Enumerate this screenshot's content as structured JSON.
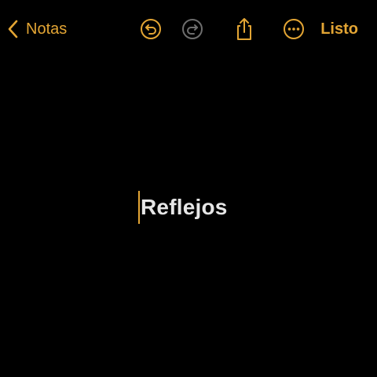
{
  "toolbar": {
    "back_label": "Notas",
    "done_label": "Listo",
    "icons": {
      "back": "chevron-left-icon",
      "undo": "undo-icon",
      "redo": "redo-icon",
      "share": "share-icon",
      "more": "more-icon"
    },
    "redo_enabled": false
  },
  "note": {
    "title": "Reflejos"
  },
  "colors": {
    "accent": "#e3a534",
    "background": "#000000",
    "text": "#e6e6e6",
    "disabled_icon": "#6e6e6e"
  }
}
